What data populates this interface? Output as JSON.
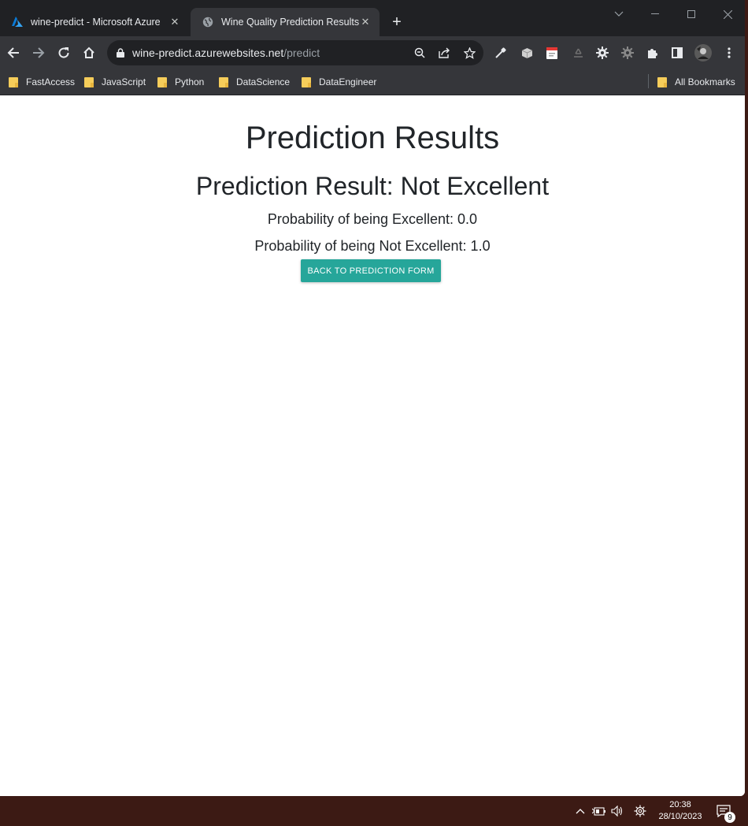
{
  "browser": {
    "tabs": [
      {
        "title": "wine-predict - Microsoft Azure",
        "icon": "azure-logo-icon",
        "active": false
      },
      {
        "title": "Wine Quality Prediction Results",
        "icon": "globe-icon",
        "active": true
      }
    ],
    "url_host": "wine-predict.azurewebsites.net",
    "url_path": "/predict",
    "bookmarks": [
      {
        "label": "FastAccess"
      },
      {
        "label": "JavaScript"
      },
      {
        "label": "Python"
      },
      {
        "label": "DataScience"
      },
      {
        "label": "DataEngineer"
      }
    ],
    "all_bookmarks_label": "All Bookmarks"
  },
  "page": {
    "title": "Prediction Results",
    "result": "Prediction Result: Not Excellent",
    "prob_excellent": "Probability of being Excellent: 0.0",
    "prob_not_excellent": "Probability of being Not Excellent: 1.0",
    "back_button": "Back to Prediction Form",
    "accent_color": "#26a69a"
  },
  "taskbar": {
    "time": "20:38",
    "date": "28/10/2023",
    "notification_count": "9"
  }
}
